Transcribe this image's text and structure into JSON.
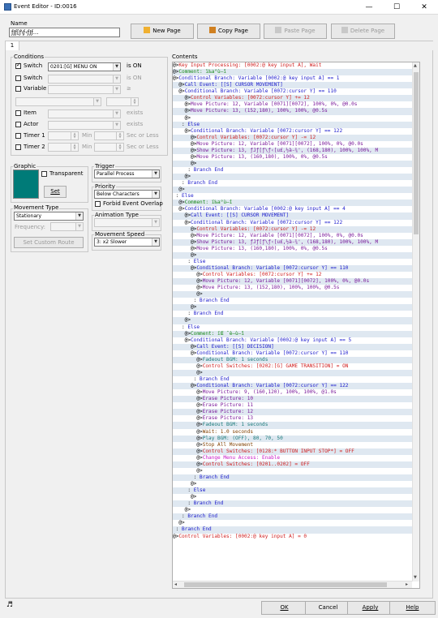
{
  "window": {
    "title": "Event Editor - ID:0016",
    "minimize": "—",
    "maximize": "☐",
    "close": "✕"
  },
  "name": {
    "label": "Name",
    "value": "ƒJƒ[ƒ\\ƒ‹ƒJƒ..."
  },
  "toolbar": {
    "new_page": "New Page",
    "copy_page": "Copy Page",
    "paste_page": "Paste Page",
    "delete_page": "Delete Page"
  },
  "page_tab": "1",
  "conditions": {
    "label": "Conditions",
    "switch1": {
      "label": "Switch",
      "checked": true,
      "value": "0201:[G] MENU ON",
      "suffix": "is ON"
    },
    "switch2": {
      "label": "Switch",
      "checked": false,
      "suffix": "is ON"
    },
    "variable": {
      "label": "Variable",
      "checked": false,
      "suffix": "≥"
    },
    "item": {
      "label": "Item",
      "checked": false,
      "suffix": "exists"
    },
    "actor": {
      "label": "Actor",
      "checked": false,
      "suffix": "exists"
    },
    "timer1": {
      "label": "Timer 1",
      "checked": false,
      "min": "Min",
      "suffix": "Sec or Less"
    },
    "timer2": {
      "label": "Timer 2",
      "checked": false,
      "min": "Min",
      "suffix": "Sec or Less"
    }
  },
  "graphic": {
    "label": "Graphic",
    "transparent": "Transparent",
    "set_button": "Set",
    "color": "#007b78"
  },
  "trigger": {
    "label": "Trigger",
    "value": "Parallel Process"
  },
  "priority": {
    "label": "Priority",
    "value": "Below Characters",
    "forbid_overlap": "Forbid Event Overlap"
  },
  "movement_type": {
    "label": "Movement Type",
    "value": "Stationary",
    "frequency_label": "Frequency:",
    "set_custom_route": "Set Custom Route"
  },
  "animation_type": {
    "label": "Animation Type"
  },
  "movement_speed": {
    "label": "Movement Speed",
    "value": "3: x2 Slower"
  },
  "contents": {
    "label": "Contents",
    "rows": [
      [
        "@>",
        "t-switch",
        "Key Input Processing: [0002:@ key input A], Wait"
      ],
      [
        "@>",
        "t-comment",
        "Comment: ï‰a°ù—î"
      ],
      [
        "@>",
        "t-branch",
        "Conditional Branch: Variable [0002:@ key input A] == 1"
      ],
      [
        "  @>",
        "t-branch",
        "Call Event: [[S] CURSOR MOVEMENT]"
      ],
      [
        "  @>",
        "t-branch",
        "Conditional Branch: Variable [0072:cursor Y] == 110"
      ],
      [
        "    @>",
        "t-switch",
        "Control Variables: [0072:cursor Y] += 12"
      ],
      [
        "    @>",
        "t-picture",
        "Move Picture: 12, Variable [0071][0072], 100%, 0%, @0.0s"
      ],
      [
        "    @>",
        "t-picture",
        "Move Picture: 13, (152,180), 100%, 100%, @0.5s"
      ],
      [
        "    @>",
        "t-plain",
        ""
      ],
      [
        "   : ",
        "t-branch",
        "Else"
      ],
      [
        "    @>",
        "t-branch",
        "Conditional Branch: Variable [0072:cursor Y] == 122"
      ],
      [
        "      @>",
        "t-switch",
        "Control Variables: [0072:cursor Y] -= 12"
      ],
      [
        "      @>",
        "t-picture",
        "Move Picture: 12, Variable [0071][0072], 100%, 0%, @0.0s"
      ],
      [
        "      @>",
        "t-picture",
        "Show Picture: 13, ƒJƒ[ƒ\\ƒ‹[u£,½à-¾', (168,180), 100%, 100%, M"
      ],
      [
        "      @>",
        "t-picture",
        "Move Picture: 13, (160,180), 100%, 0%, @0.5s"
      ],
      [
        "      @>",
        "t-plain",
        ""
      ],
      [
        "     : ",
        "t-branch",
        "Branch End"
      ],
      [
        "    @>",
        "t-plain",
        ""
      ],
      [
        "   : ",
        "t-branch",
        "Branch End"
      ],
      [
        "  @>",
        "t-plain",
        ""
      ],
      [
        " : ",
        "t-branch",
        "Else"
      ],
      [
        "  @>",
        "t-comment",
        "Comment: ï‰a°ù—î"
      ],
      [
        "  @>",
        "t-branch",
        "Conditional Branch: Variable [0002:@ key input A] == 4"
      ],
      [
        "    @>",
        "t-branch",
        "Call Event: [[S] CURSOR MOVEMENT]"
      ],
      [
        "    @>",
        "t-branch",
        "Conditional Branch: Variable [0072:cursor Y] == 122"
      ],
      [
        "      @>",
        "t-switch",
        "Control Variables: [0072:cursor Y] -= 12"
      ],
      [
        "      @>",
        "t-picture",
        "Move Picture: 12, Variable [0071][0072], 100%, 0%, @0.0s"
      ],
      [
        "      @>",
        "t-picture",
        "Show Picture: 13, ƒJƒ[ƒ\\ƒ‹[u£,½à-¾', (168,180), 100%, 100%, M"
      ],
      [
        "      @>",
        "t-picture",
        "Move Picture: 13, (160,180), 100%, 0%, @0.5s"
      ],
      [
        "      @>",
        "t-plain",
        ""
      ],
      [
        "     : ",
        "t-branch",
        "Else"
      ],
      [
        "      @>",
        "t-branch",
        "Conditional Branch: Variable [0072:cursor Y] == 110"
      ],
      [
        "        @>",
        "t-switch",
        "Control Variables: [0072:cursor Y] += 12"
      ],
      [
        "        @>",
        "t-picture",
        "Move Picture: 12, Variable [0071][0072], 100%, 0%, @0.0s"
      ],
      [
        "        @>",
        "t-picture",
        "Move Picture: 13, (152,180), 100%, 100%, @0.5s"
      ],
      [
        "        @>",
        "t-plain",
        ""
      ],
      [
        "       : ",
        "t-branch",
        "Branch End"
      ],
      [
        "      @>",
        "t-plain",
        ""
      ],
      [
        "     : ",
        "t-branch",
        "Branch End"
      ],
      [
        "    @>",
        "t-plain",
        ""
      ],
      [
        "   : ",
        "t-branch",
        "Else"
      ],
      [
        "    @>",
        "t-comment",
        "Comment: ïŒ ˆè—ù—î"
      ],
      [
        "    @>",
        "t-branch",
        "Conditional Branch: Variable [0002:@ key input A] == 5"
      ],
      [
        "      @>",
        "t-branch",
        "Call Event: [[S] DECISION]"
      ],
      [
        "      @>",
        "t-branch",
        "Conditional Branch: Variable [0072:cursor Y] == 110"
      ],
      [
        "        @>",
        "t-audio",
        "Fadeout BGM: 1 seconds"
      ],
      [
        "        @>",
        "t-switch",
        "Control Switches: [0202:[G] GAME TRANSITION] = ON"
      ],
      [
        "        @>",
        "t-plain",
        ""
      ],
      [
        "       : ",
        "t-branch",
        "Branch End"
      ],
      [
        "      @>",
        "t-branch",
        "Conditional Branch: Variable [0072:cursor Y] == 122"
      ],
      [
        "        @>",
        "t-picture",
        "Move Picture: 9, (160,120), 100%, 100%, @1.0s"
      ],
      [
        "        @>",
        "t-picture",
        "Erase Picture: 10"
      ],
      [
        "        @>",
        "t-picture",
        "Erase Picture: 11"
      ],
      [
        "        @>",
        "t-picture",
        "Erase Picture: 12"
      ],
      [
        "        @>",
        "t-picture",
        "Erase Picture: 13"
      ],
      [
        "        @>",
        "t-audio",
        "Fadeout BGM: 1 seconds"
      ],
      [
        "        @>",
        "t-misc",
        "Wait: 1.0 seconds"
      ],
      [
        "        @>",
        "t-audio",
        "Play BGM: (OFF), 80, 70, 50"
      ],
      [
        "        @>",
        "t-misc",
        "Stop All Movement"
      ],
      [
        "        @>",
        "t-switch",
        "Control Switches: [0128:* BUTTON INPUT STOP*] = OFF"
      ],
      [
        "        @>",
        "t-menu",
        "Change Menu Access: Enable"
      ],
      [
        "        @>",
        "t-switch",
        "Control Switches: [0201..0202] = OFF"
      ],
      [
        "        @>",
        "t-plain",
        ""
      ],
      [
        "       : ",
        "t-branch",
        "Branch End"
      ],
      [
        "      @>",
        "t-plain",
        ""
      ],
      [
        "     : ",
        "t-branch",
        "Else"
      ],
      [
        "      @>",
        "t-plain",
        ""
      ],
      [
        "     : ",
        "t-branch",
        "Branch End"
      ],
      [
        "    @>",
        "t-plain",
        ""
      ],
      [
        "   : ",
        "t-branch",
        "Branch End"
      ],
      [
        "  @>",
        "t-plain",
        ""
      ],
      [
        " : ",
        "t-branch",
        "Branch End"
      ],
      [
        "@>",
        "t-switch",
        "Control Variables: [0002:@ key input A] = 0"
      ]
    ]
  },
  "footer": {
    "ok": "OK",
    "cancel": "Cancel",
    "apply": "Apply",
    "help": "Help",
    "note_icon": "♬"
  }
}
